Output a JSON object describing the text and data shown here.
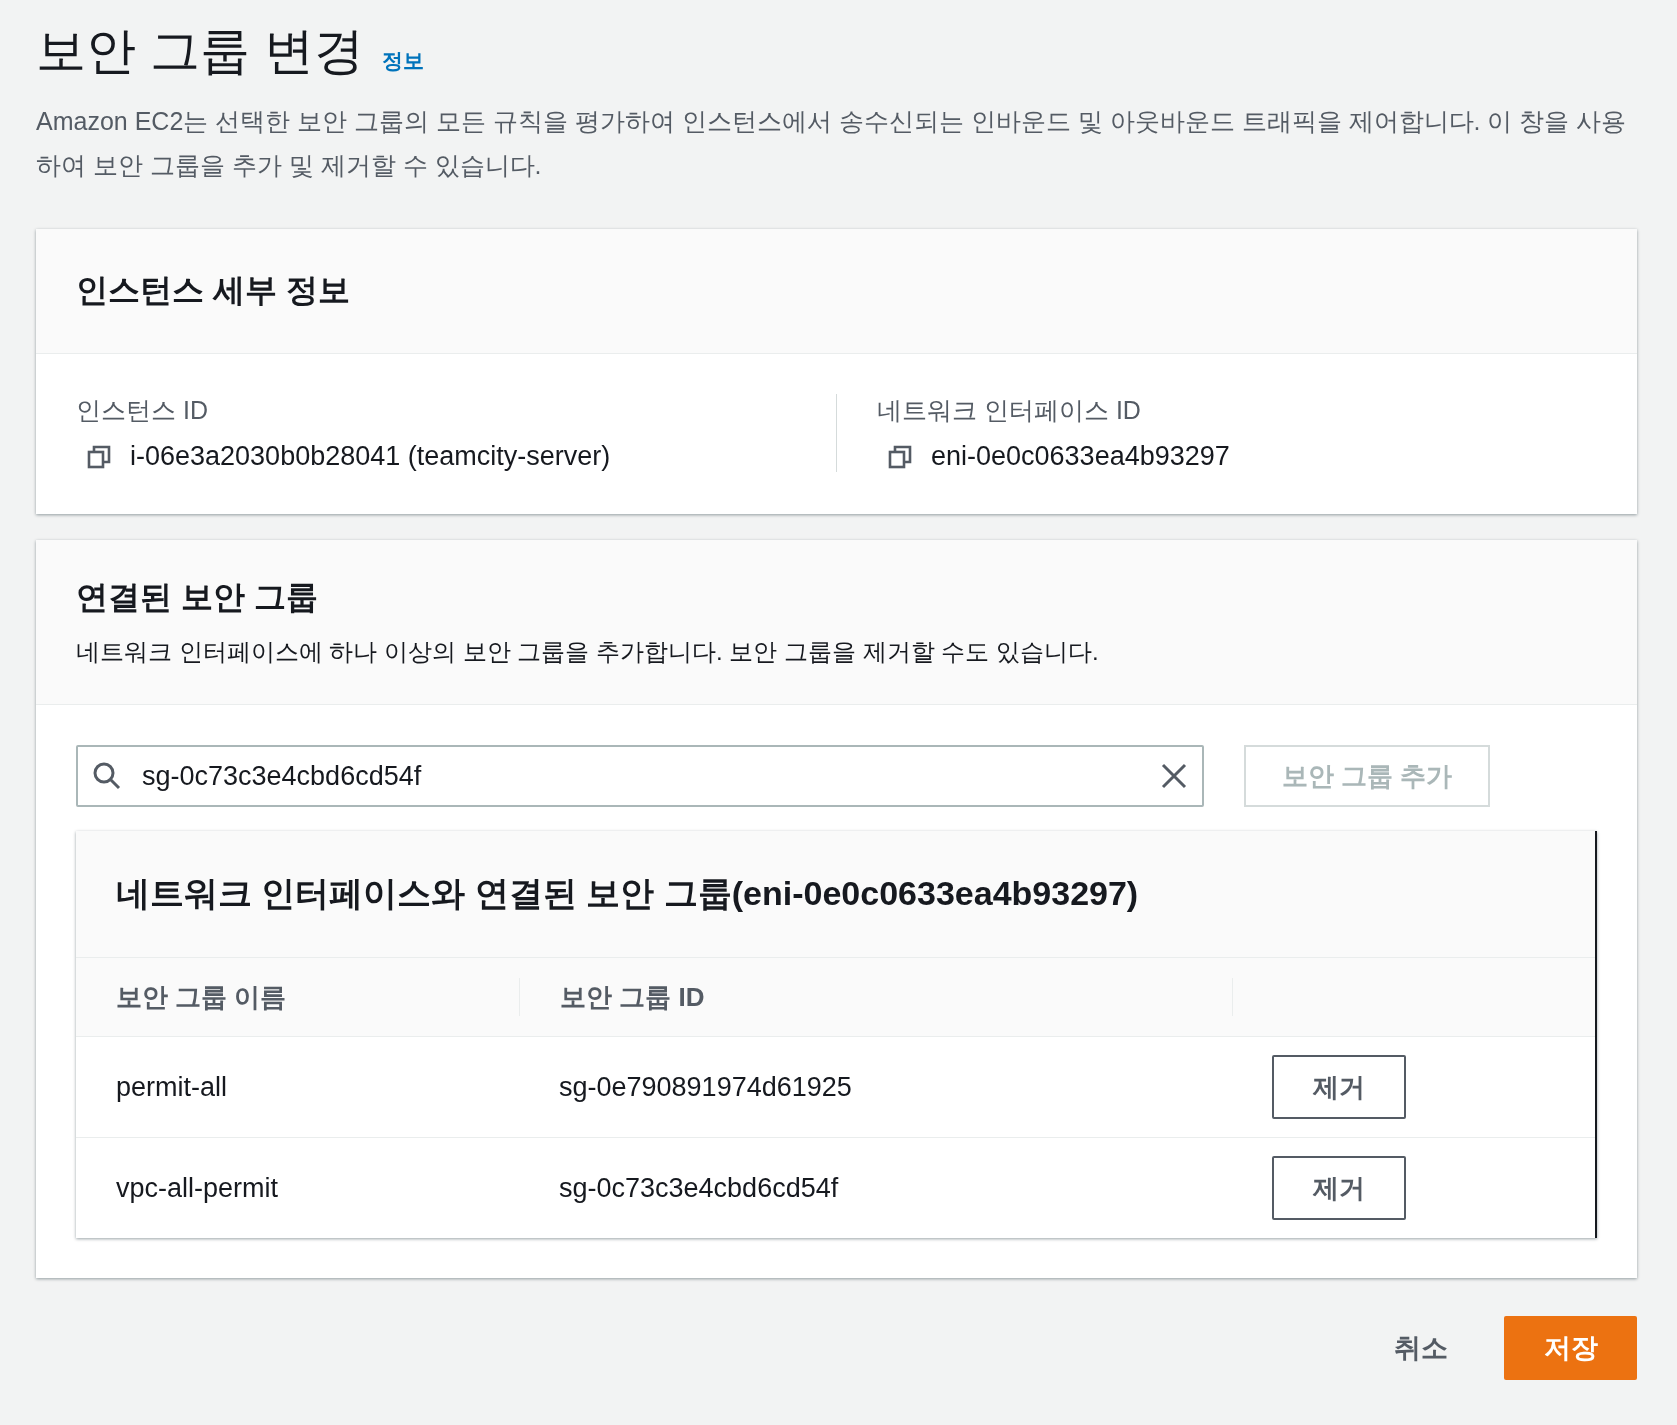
{
  "title": "보안 그룹 변경",
  "info_link": "정보",
  "description": "Amazon EC2는 선택한 보안 그룹의 모든 규칙을 평가하여 인스턴스에서 송수신되는 인바운드 및 아웃바운드 트래픽을 제어합니다. 이 창을 사용하여 보안 그룹을 추가 및 제거할 수 있습니다.",
  "instance_details": {
    "title": "인스턴스 세부 정보",
    "fields": [
      {
        "label": "인스턴스 ID",
        "value": "i-06e3a2030b0b28041 (teamcity-server)"
      },
      {
        "label": "네트워크 인터페이스 ID",
        "value": "eni-0e0c0633ea4b93297"
      }
    ]
  },
  "associated_groups": {
    "title": "연결된 보안 그룹",
    "description": "네트워크 인터페이스에 하나 이상의 보안 그룹을 추가합니다. 보안 그룹을 제거할 수도 있습니다.",
    "search": {
      "value": "sg-0c73c3e4cbd6cd54f"
    },
    "add_button": {
      "label": "보안 그룹 추가",
      "disabled": true
    },
    "table": {
      "title": "네트워크 인터페이스와 연결된 보안 그룹(eni-0e0c0633ea4b93297)",
      "columns": [
        "보안 그룹 이름",
        "보안 그룹 ID"
      ],
      "rows": [
        {
          "name": "permit-all",
          "id": "sg-0e790891974d61925",
          "action": "제거"
        },
        {
          "name": "vpc-all-permit",
          "id": "sg-0c73c3e4cbd6cd54f",
          "action": "제거"
        }
      ]
    }
  },
  "footer": {
    "cancel": "취소",
    "save": "저장"
  }
}
